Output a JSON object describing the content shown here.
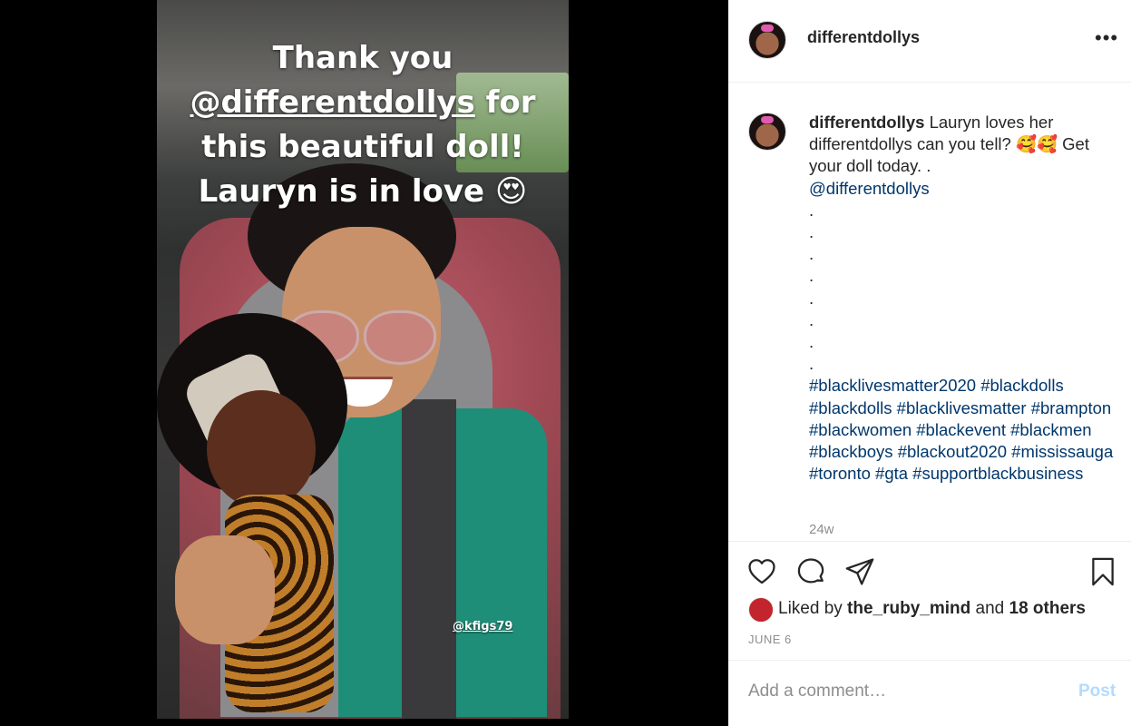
{
  "story": {
    "line1": "Thank you",
    "mention": "@differentdollys",
    "line2_suffix": " for",
    "line3": "this beautiful doll!",
    "line4": "Lauryn is in love 😍",
    "credit": "@kfigs79"
  },
  "header": {
    "username": "differentdollys",
    "more": "•••"
  },
  "caption": {
    "username": "differentdollys",
    "text": "Lauryn loves her differentdollys can you tell? 🥰🥰 Get your doll today. .",
    "mention": "@differentdollys",
    "dots": ".\n.\n.\n.\n.\n.\n.\n.",
    "hashtags": "#blacklivesmatter2020 #blackdolls #blackdolls #blacklivesmatter #brampton #blackwomen #blackevent #blackmen #blackboys #blackout2020 #mississauga #toronto #gta #supportblackbusiness",
    "time": "24w"
  },
  "likes": {
    "prefix": "Liked by ",
    "user": "the_ruby_mind",
    "middle": " and ",
    "others": "18 others"
  },
  "date": "JUNE 6",
  "comment": {
    "placeholder": "Add a comment…",
    "post_label": "Post"
  },
  "colors": {
    "link": "#00376b",
    "post_disabled": "#b3dbff",
    "secondary_text": "#8e8e8e"
  },
  "icons": [
    "heart-icon",
    "comment-icon",
    "share-icon",
    "bookmark-icon",
    "more-icon"
  ]
}
